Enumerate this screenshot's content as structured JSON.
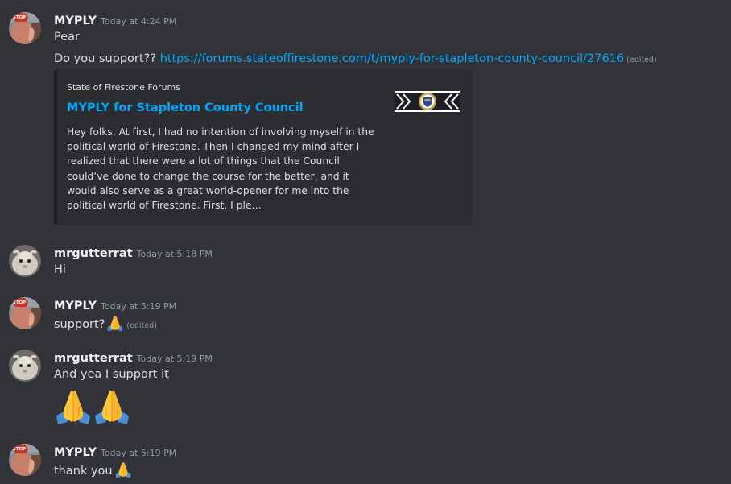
{
  "messages": [
    {
      "author": "MYPLY",
      "timestamp": "Today at 4:24 PM",
      "lines": {
        "l1": "Pear",
        "l2_prefix": "Do you support??",
        "l2_link": "https://forums.stateoffirestone.com/t/myply-for-stapleton-county-council/27616",
        "l2_edited": "(edited)"
      },
      "embed": {
        "provider": "State of Firestone Forums",
        "title": "MYPLY for Stapleton County Council",
        "description": "Hey folks, At first, I had no intention of involving myself in the political world of Firestone. Then I changed my mind after I realized that there were a lot of things that the Council could’ve done to change the course for the better, and it would also serve as a great world-opener for me into the political world of Firestone. First, I ple…",
        "thumbnail_icon": "firestone-seal-banner-icon"
      }
    },
    {
      "author": "mrgutterrat",
      "timestamp": "Today at 5:18 PM",
      "text": "Hi"
    },
    {
      "author": "MYPLY",
      "timestamp": "Today at 5:19 PM",
      "text": "support?",
      "emoji": "folded-hands-emoji",
      "edited": "(edited)"
    },
    {
      "author": "mrgutterrat",
      "timestamp": "Today at 5:19 PM",
      "text": "And yea I support it",
      "big_emojis": [
        "folded-hands-emoji",
        "folded-hands-emoji"
      ]
    },
    {
      "author": "MYPLY",
      "timestamp": "Today at 5:19 PM",
      "text": "thank you",
      "emoji": "folded-hands-emoji"
    }
  ],
  "colors": {
    "background": "#313338",
    "link": "#00a8fc",
    "embed_bg": "#2b2d31",
    "author": "#f2f3f5",
    "text": "#dbdee1",
    "timestamp": "#949ba4"
  }
}
